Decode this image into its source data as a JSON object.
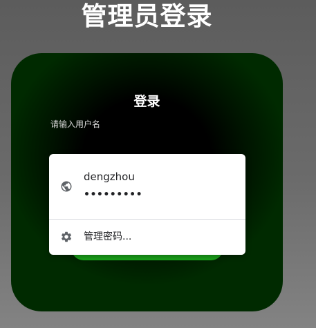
{
  "page": {
    "title": "管理员登录"
  },
  "login": {
    "heading": "登录",
    "username_label": "请输入用户名"
  },
  "autofill": {
    "suggestion": {
      "username": "dengzhou",
      "password_mask": "•••••••••",
      "icon": "globe-icon"
    },
    "manage": {
      "label": "管理密码...",
      "icon": "gear-icon"
    }
  },
  "colors": {
    "card_glow": "#002a00",
    "button": "#1aa01a",
    "popup_bg": "#ffffff",
    "icon": "#5f6368"
  }
}
